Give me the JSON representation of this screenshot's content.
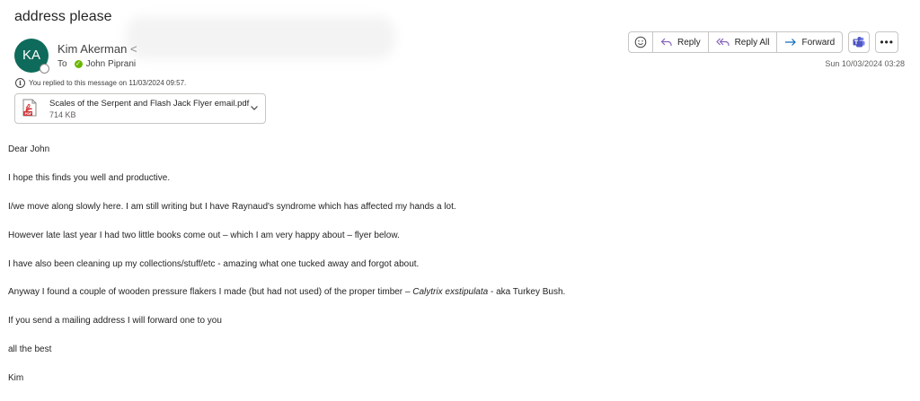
{
  "email": {
    "subject": "address please",
    "sender": {
      "initials": "KA",
      "name": "Kim Akerman",
      "name_suffix": "<",
      "avatar_color": "#0e6b5b"
    },
    "to_label": "To",
    "recipient": "John Piprani",
    "replied_notice": "You replied to this message on 11/03/2024 09:57.",
    "timestamp": "Sun 10/03/2024 03:28",
    "attachment": {
      "name": "Scales of the Serpent and Flash Jack Flyer email.pdf",
      "size": "714 KB",
      "icon": "pdf-icon"
    },
    "toolbar": {
      "emoji_icon": "emoji-smile-icon",
      "reply": "Reply",
      "reply_all": "Reply All",
      "forward": "Forward",
      "teams_icon": "teams-icon",
      "more": "•••"
    },
    "body": {
      "greeting": "Dear John",
      "p1": "I hope this finds you well and productive.",
      "p2": "I/we move along slowly here. I am still writing but I have Raynaud's syndrome which has affected my hands a lot.",
      "p3": "However late last year I had two little books come out – which I am very happy about – flyer below.",
      "p4": "I have also been cleaning up my collections/stuff/etc - amazing what one tucked away and forgot about.",
      "p5_before": "Anyway I found a couple of wooden pressure flakers I made (but had not used) of the proper timber – ",
      "p5_italic": "Calytrix exstipulata",
      "p5_after": " - aka Turkey Bush.",
      "p6": "If you send a mailing address I will forward one to you",
      "closing": "all the best",
      "signature": "Kim"
    }
  }
}
